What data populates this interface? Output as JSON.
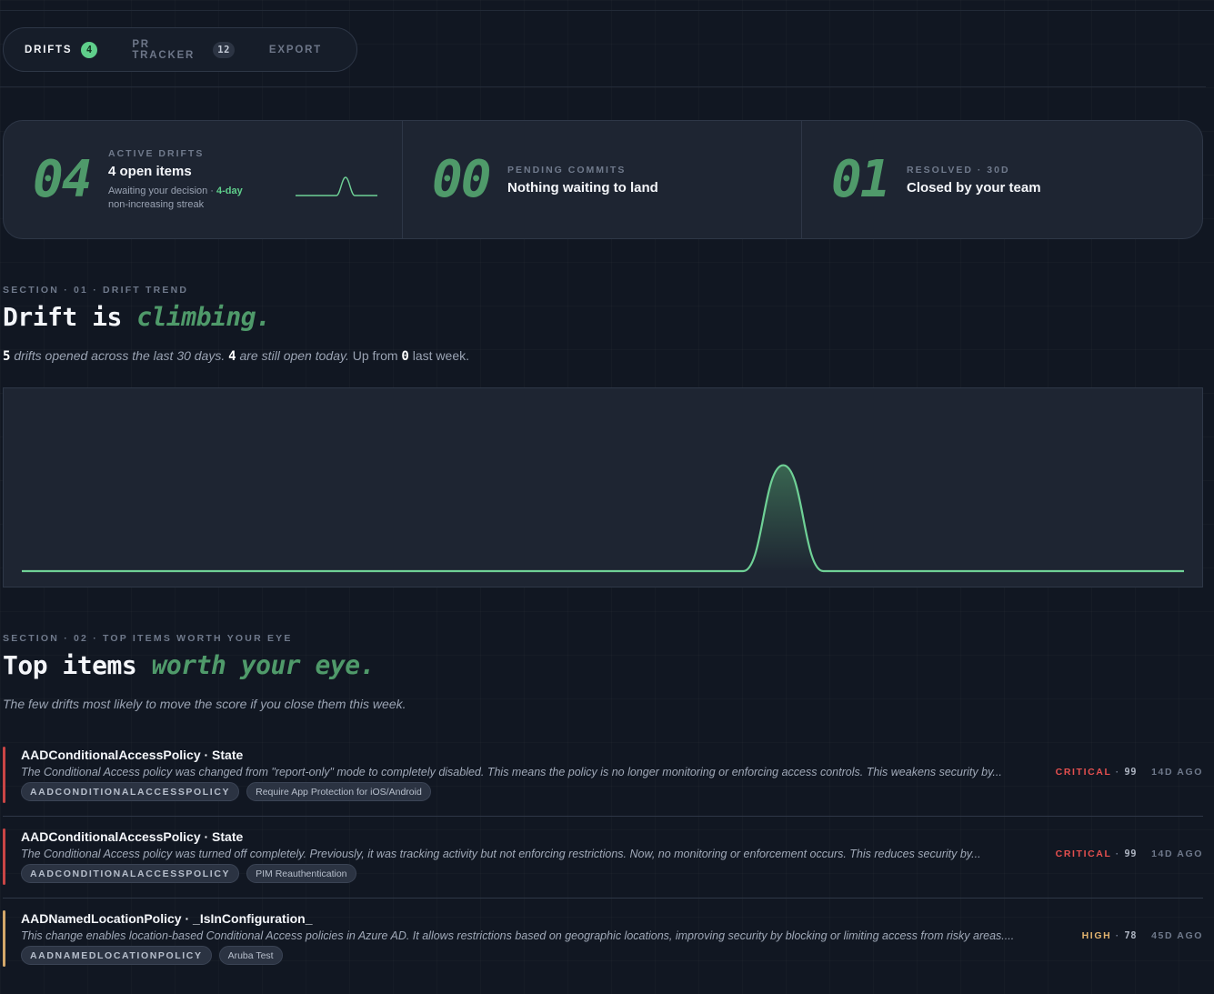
{
  "nav": {
    "tabs": [
      {
        "label": "DRIFTS",
        "badge": "4",
        "active": true
      },
      {
        "label": "PR TRACKER",
        "badge": "12",
        "active": false
      },
      {
        "label": "EXPORT",
        "badge": null,
        "active": false
      }
    ]
  },
  "stats": [
    {
      "number": "04",
      "label": "ACTIVE DRIFTS",
      "title": "4 open items",
      "sub_prefix": "Awaiting your decision · ",
      "sub_accent": "4-day",
      "sub_suffix": "non-increasing streak"
    },
    {
      "number": "00",
      "label": "PENDING COMMITS",
      "title": "Nothing waiting to land"
    },
    {
      "number": "01",
      "label": "RESOLVED · 30D",
      "title": "Closed by your team"
    }
  ],
  "section1": {
    "label": "SECTION · 01 · DRIFT TREND",
    "title_plain": "Drift is ",
    "title_em": "climbing.",
    "desc": {
      "n1": "5",
      "t1": " drifts opened across the last 30 days. ",
      "n2": "4",
      "t2": " are still open today.",
      "t3": " Up from ",
      "n3": "0",
      "t4": " last week."
    }
  },
  "chart_data": {
    "type": "area",
    "x": [
      1,
      2,
      3,
      4,
      5,
      6,
      7,
      8,
      9,
      10,
      11,
      12,
      13,
      14,
      15,
      16,
      17,
      18,
      19,
      20,
      21,
      22,
      23,
      24,
      25,
      26,
      27,
      28,
      29,
      30
    ],
    "values": [
      0,
      0,
      0,
      0,
      0,
      0,
      0,
      0,
      0,
      0,
      0,
      0,
      0,
      0,
      0,
      0,
      0,
      0,
      0,
      4,
      0,
      0,
      0,
      0,
      0,
      0,
      0,
      0,
      0,
      0
    ],
    "ylim": [
      0,
      4.5
    ],
    "grid": false,
    "colors": {
      "line": "#6fd196",
      "fill": "#4f9a6a"
    }
  },
  "section2": {
    "label": "SECTION · 02 · TOP ITEMS WORTH YOUR EYE",
    "title_plain": "Top items ",
    "title_em": "worth your eye.",
    "desc": "The few drifts most likely to move the score if you close them this week."
  },
  "items": [
    {
      "title": "AADConditionalAccessPolicy · State",
      "desc": "The Conditional Access policy was changed from \"report-only\" mode to completely disabled. This means the policy is no longer monitoring or enforcing access controls. This weakens security by...",
      "tags": [
        "AADCONDITIONALACCESSPOLICY",
        "Require App Protection for iOS/Android"
      ],
      "severity": "CRITICAL",
      "score": "99",
      "ago": "14D AGO",
      "color": "#c94545"
    },
    {
      "title": "AADConditionalAccessPolicy · State",
      "desc": "The Conditional Access policy was turned off completely. Previously, it was tracking activity but not enforcing restrictions. Now, no monitoring or enforcement occurs. This reduces security by...",
      "tags": [
        "AADCONDITIONALACCESSPOLICY",
        "PIM Reauthentication"
      ],
      "severity": "CRITICAL",
      "score": "99",
      "ago": "14D AGO",
      "color": "#c94545"
    },
    {
      "title": "AADNamedLocationPolicy · _IsInConfiguration_",
      "desc": "This change enables location-based Conditional Access policies in Azure AD. It allows restrictions based on geographic locations, improving security by blocking or limiting access from risky areas....",
      "tags": [
        "AADNAMEDLOCATIONPOLICY",
        "Aruba Test"
      ],
      "severity": "HIGH",
      "score": "78",
      "ago": "45D AGO",
      "color": "#d4a86a"
    }
  ]
}
